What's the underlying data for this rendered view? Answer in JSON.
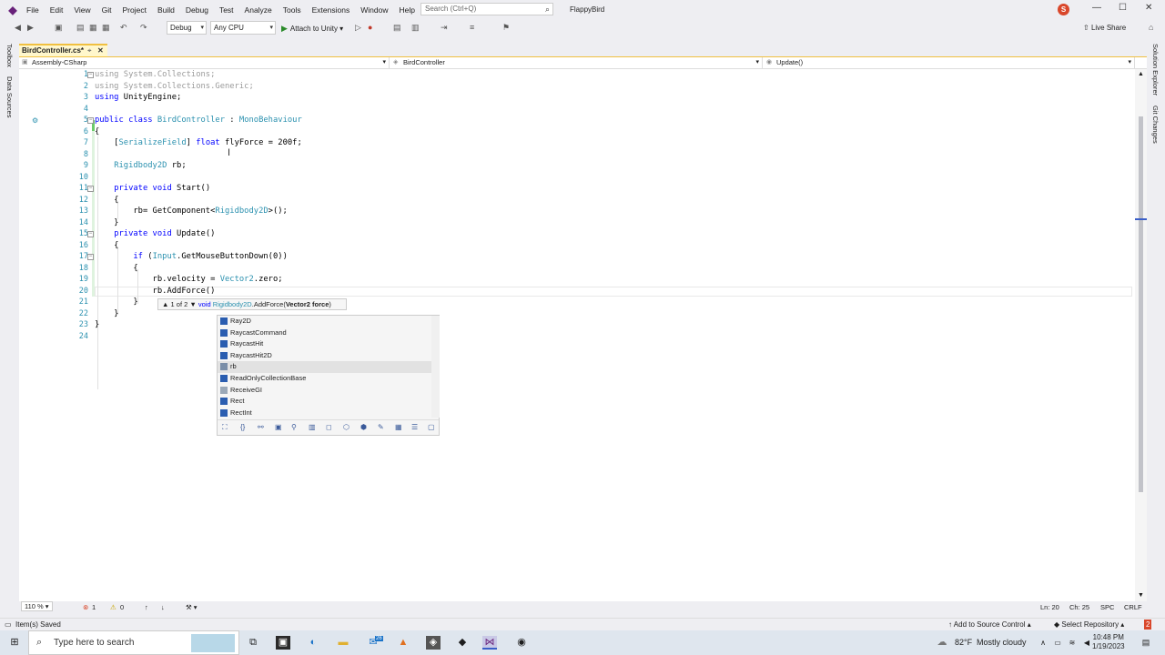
{
  "menu": {
    "logo": "VS",
    "items": [
      "File",
      "Edit",
      "View",
      "Git",
      "Project",
      "Build",
      "Debug",
      "Test",
      "Analyze",
      "Tools",
      "Extensions",
      "Window",
      "Help"
    ],
    "search_placeholder": "Search (Ctrl+Q)",
    "solution_name": "FlappyBird",
    "avatar_initial": "S"
  },
  "toolbar": {
    "config": "Debug",
    "platform": "Any CPU",
    "attach_label": "Attach to Unity",
    "live_share": "Live Share"
  },
  "left_strip": {
    "toolbox": "Toolbox",
    "data_sources": "Data Sources"
  },
  "right_strip": {
    "solution_explorer": "Solution Explorer",
    "git_changes": "Git Changes"
  },
  "tab": {
    "filename": "BirdController.cs*"
  },
  "navbar": {
    "project": "Assembly-CSharp",
    "class": "BirdController",
    "member": "Update()"
  },
  "code": {
    "line_numbers": [
      "1",
      "2",
      "3",
      "4",
      "5",
      "6",
      "7",
      "8",
      "9",
      "10",
      "11",
      "12",
      "13",
      "14",
      "15",
      "16",
      "17",
      "18",
      "19",
      "20",
      "21",
      "22",
      "23",
      "24"
    ]
  },
  "param_info": {
    "counter": "1 of 2",
    "ret": "void",
    "type": "Rigidbody2D",
    "sig": ".AddForce(",
    "param": "Vector2 force",
    "close": ")"
  },
  "completion": {
    "items": [
      "Ray2D",
      "RaycastCommand",
      "RaycastHit",
      "RaycastHit2D",
      "rb",
      "ReadOnlyCollectionBase",
      "ReceiveGI",
      "Rect",
      "RectInt"
    ],
    "selected_index": 4
  },
  "editor_status": {
    "zoom": "110 %",
    "errors": "1",
    "warnings": "0",
    "ln": "Ln: 20",
    "ch": "Ch: 25",
    "spc": "SPC",
    "crlf": "CRLF"
  },
  "statusbar": {
    "left": "Item(s) Saved",
    "source_control": "Add to Source Control",
    "repo": "Select Repository",
    "notif": "2"
  },
  "taskbar": {
    "search": "Type here to search",
    "weather_temp": "82°F",
    "weather_desc": "Mostly cloudy",
    "time": "10:48 PM",
    "date": "1/19/2023",
    "mail_badge": "26"
  }
}
